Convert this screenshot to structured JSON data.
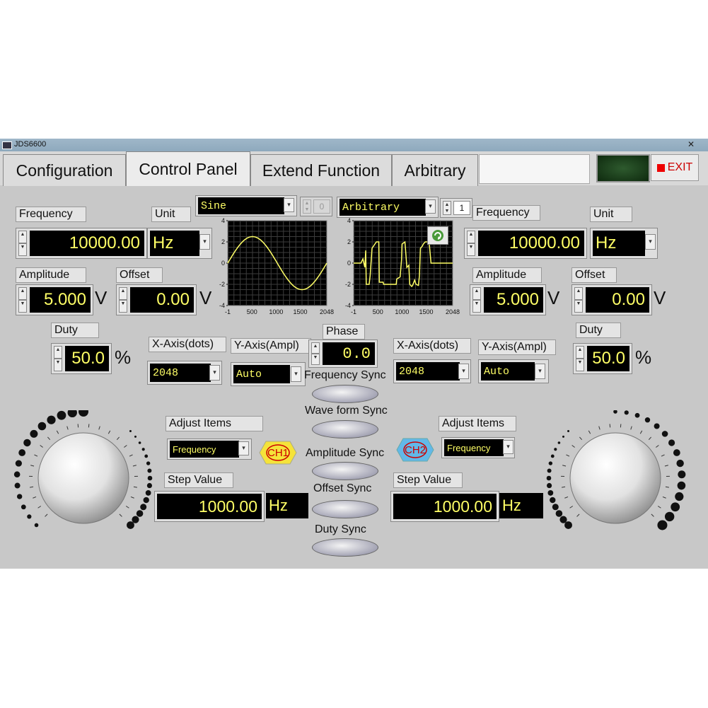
{
  "window": {
    "title": "JDS6600",
    "close_glyph": "✕"
  },
  "tabs": [
    {
      "label": "Configuration"
    },
    {
      "label": "Control Panel"
    },
    {
      "label": "Extend Function"
    },
    {
      "label": "Arbitrary"
    }
  ],
  "exit_label": "EXIT",
  "ch1": {
    "frequency_label": "Frequency",
    "frequency_value": "10000.00",
    "unit_label": "Unit",
    "unit_value": "Hz",
    "amplitude_label": "Amplitude",
    "amplitude_value": "5.000",
    "amplitude_unit": "V",
    "offset_label": "Offset",
    "offset_value": "0.00",
    "offset_unit": "V",
    "duty_label": "Duty",
    "duty_value": "50.0",
    "duty_unit": "%",
    "waveform": "Sine",
    "waveform_index": "0",
    "xaxis_label": "X-Axis(dots)",
    "xaxis_value": "2048",
    "yaxis_label": "Y-Axis(Ampl)",
    "yaxis_value": "Auto",
    "adjust_items_label": "Adjust Items",
    "adjust_items_value": "Frequency",
    "step_label": "Step Value",
    "step_value": "1000.00",
    "step_unit": "Hz",
    "badge": "CH1",
    "badge_color": "#f5e33a"
  },
  "ch2": {
    "frequency_label": "Frequency",
    "frequency_value": "10000.00",
    "unit_label": "Unit",
    "unit_value": "Hz",
    "amplitude_label": "Amplitude",
    "amplitude_value": "5.000",
    "amplitude_unit": "V",
    "offset_label": "Offset",
    "offset_value": "0.00",
    "offset_unit": "V",
    "duty_label": "Duty",
    "duty_value": "50.0",
    "duty_unit": "%",
    "waveform": "Arbitrary",
    "waveform_index": "1",
    "xaxis_label": "X-Axis(dots)",
    "xaxis_value": "2048",
    "yaxis_label": "Y-Axis(Ampl)",
    "yaxis_value": "Auto",
    "adjust_items_label": "Adjust Items",
    "adjust_items_value": "Frequency",
    "step_label": "Step Value",
    "step_value": "1000.00",
    "step_unit": "Hz",
    "badge": "CH2",
    "badge_color": "#62b8e8"
  },
  "phase": {
    "label": "Phase",
    "value": "0.0"
  },
  "sync": {
    "frequency": "Frequency Sync",
    "waveform": "Wave form Sync",
    "amplitude": "Amplitude Sync",
    "offset": "Offset Sync",
    "duty": "Duty  Sync"
  },
  "graphs": {
    "x_ticks": [
      "-1",
      "500",
      "1000",
      "1500",
      "2048"
    ],
    "y_ticks": [
      "4",
      "2",
      "0",
      "-2",
      "-4"
    ],
    "trace_color": "#ffff66"
  }
}
